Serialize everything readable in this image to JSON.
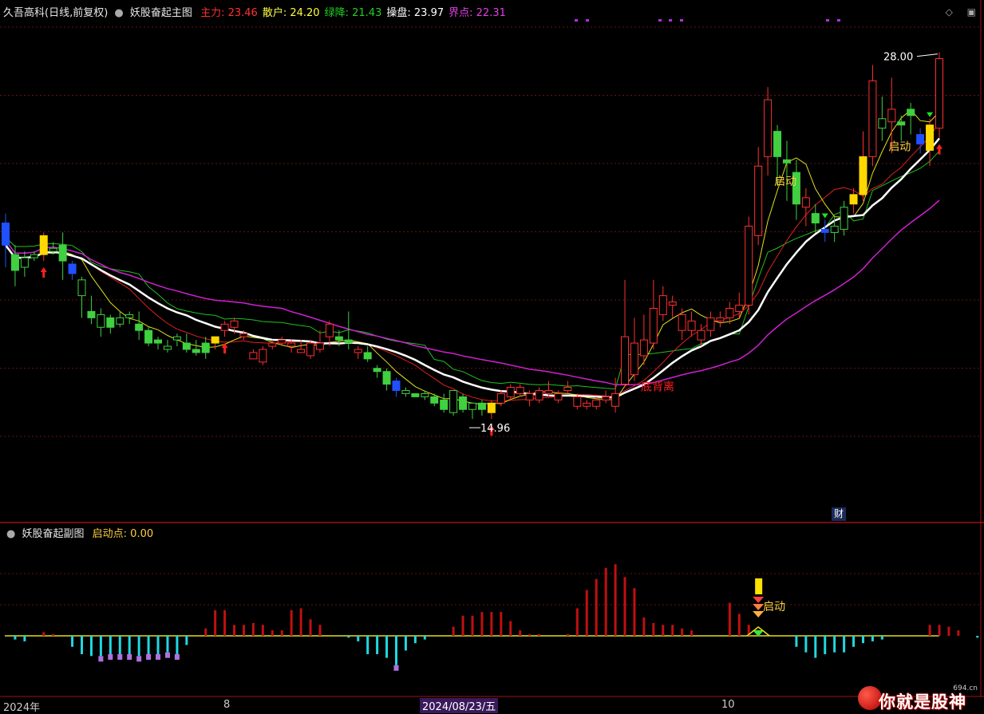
{
  "header": {
    "stock": "久吾高科(日线,前复权)",
    "main_indicator": "妖股奋起主图",
    "items": [
      {
        "label": "主力",
        "value": "23.46",
        "color": "#ff3030"
      },
      {
        "label": "散户",
        "value": "24.20",
        "color": "#ffff40"
      },
      {
        "label": "绿降",
        "value": "21.43",
        "color": "#20d020"
      },
      {
        "label": "操盘",
        "value": "23.97",
        "color": "#ffffff"
      },
      {
        "label": "界点",
        "value": "22.31",
        "color": "#e040e0"
      }
    ],
    "sep": ":"
  },
  "sub_header": {
    "indicator": "妖股奋起副图",
    "label": "启动点",
    "value": "0.00"
  },
  "window_buttons": [
    "◇",
    "▣"
  ],
  "date_axis": {
    "labels": [
      "2024年",
      "8",
      "10"
    ],
    "selected": "2024/08/23/五"
  },
  "logo": {
    "text": "你就是股神",
    "small": "694.cn"
  },
  "badge": "财",
  "chart_data": [
    {
      "type": "candlestick",
      "title": "妖股奋起主图",
      "ylim": [
        13.5,
        29
      ],
      "candles": [
        [
          22.6,
          21.9,
          22.9,
          21.2,
          "b"
        ],
        [
          21.6,
          21.1,
          21.9,
          20.6,
          "g"
        ],
        [
          21.2,
          21.5,
          21.7,
          20.9,
          "g"
        ],
        [
          21.5,
          21.6,
          21.7,
          21.4,
          "g"
        ],
        [
          21.6,
          22.2,
          22.3,
          21.4,
          "y"
        ],
        [
          21.7,
          21.8,
          22.0,
          21.6,
          "g"
        ],
        [
          21.9,
          21.4,
          22.3,
          20.8,
          "g"
        ],
        [
          21.3,
          21.0,
          21.4,
          20.8,
          "b"
        ],
        [
          20.3,
          20.8,
          20.9,
          19.6,
          "g"
        ],
        [
          19.8,
          19.6,
          20.3,
          19.4,
          "g"
        ],
        [
          19.3,
          19.7,
          19.9,
          19.0,
          "g"
        ],
        [
          19.6,
          19.3,
          19.7,
          19.1,
          "g"
        ],
        [
          19.4,
          19.6,
          19.8,
          19.3,
          "g"
        ],
        [
          19.6,
          19.7,
          19.8,
          19.4,
          "g"
        ],
        [
          19.4,
          19.2,
          19.8,
          18.9,
          "g"
        ],
        [
          19.2,
          18.8,
          19.3,
          18.7,
          "g"
        ],
        [
          18.9,
          18.8,
          19.0,
          18.6,
          "g"
        ],
        [
          18.6,
          18.7,
          18.9,
          18.5,
          "g"
        ],
        [
          18.9,
          19.0,
          19.1,
          18.7,
          "g"
        ],
        [
          18.8,
          18.6,
          19.1,
          18.5,
          "g"
        ],
        [
          18.6,
          18.5,
          18.9,
          18.4,
          "g"
        ],
        [
          18.8,
          18.5,
          19.0,
          18.3,
          "g"
        ],
        [
          19.0,
          18.8,
          19.0,
          18.6,
          "y"
        ],
        [
          19.2,
          19.4,
          19.5,
          19.0,
          "r"
        ],
        [
          19.5,
          19.3,
          19.6,
          19.1,
          "r"
        ],
        [
          19.0,
          19.1,
          19.2,
          18.9,
          "r"
        ],
        [
          18.5,
          18.3,
          18.6,
          18.3,
          "r"
        ],
        [
          18.2,
          18.6,
          18.7,
          18.1,
          "r"
        ],
        [
          18.7,
          18.8,
          18.9,
          18.6,
          "r"
        ],
        [
          18.8,
          18.9,
          19.0,
          18.7,
          "r"
        ],
        [
          18.8,
          18.7,
          18.9,
          18.5,
          "r"
        ],
        [
          18.5,
          18.6,
          18.9,
          18.5,
          "r"
        ],
        [
          18.4,
          18.8,
          18.9,
          18.3,
          "r"
        ],
        [
          18.8,
          18.6,
          19.2,
          18.5,
          "r"
        ],
        [
          19.0,
          19.4,
          19.5,
          18.7,
          "r"
        ],
        [
          19.0,
          18.9,
          19.2,
          18.7,
          "g"
        ],
        [
          18.9,
          18.8,
          19.8,
          18.6,
          "g"
        ],
        [
          18.6,
          18.5,
          18.7,
          18.3,
          "r"
        ],
        [
          18.5,
          18.3,
          18.7,
          18.2,
          "g"
        ],
        [
          18.0,
          17.9,
          18.1,
          17.7,
          "g"
        ],
        [
          17.9,
          17.5,
          18.0,
          17.3,
          "g"
        ],
        [
          17.6,
          17.3,
          17.7,
          17.1,
          "b"
        ],
        [
          17.2,
          17.3,
          17.4,
          17.1,
          "g"
        ],
        [
          17.2,
          17.1,
          17.2,
          17.1,
          "g"
        ],
        [
          17.1,
          17.2,
          17.3,
          17.0,
          "g"
        ],
        [
          17.1,
          16.9,
          17.2,
          16.8,
          "g"
        ],
        [
          17.0,
          16.7,
          17.2,
          16.6,
          "g"
        ],
        [
          16.6,
          17.3,
          17.3,
          16.5,
          "g"
        ],
        [
          17.1,
          16.7,
          17.2,
          16.6,
          "g"
        ],
        [
          16.7,
          16.9,
          16.9,
          16.4,
          "g"
        ],
        [
          16.9,
          16.7,
          17.0,
          16.5,
          "g"
        ],
        [
          16.6,
          16.9,
          17.0,
          16.4,
          "y"
        ],
        [
          16.9,
          17.2,
          17.3,
          16.8,
          "r"
        ],
        [
          17.1,
          17.4,
          17.5,
          17.0,
          "r"
        ],
        [
          17.2,
          17.4,
          17.5,
          17.1,
          "r"
        ],
        [
          17.2,
          17.0,
          17.3,
          16.8,
          "r"
        ],
        [
          17.0,
          17.3,
          17.4,
          16.9,
          "r"
        ],
        [
          17.3,
          17.2,
          17.6,
          17.1,
          "r"
        ],
        [
          17.0,
          17.2,
          17.3,
          16.9,
          "r"
        ],
        [
          17.4,
          17.3,
          17.6,
          17.2,
          "r"
        ],
        [
          17.1,
          16.8,
          17.2,
          16.7,
          "r"
        ],
        [
          16.8,
          16.9,
          17.0,
          16.7,
          "r"
        ],
        [
          16.8,
          17.0,
          17.1,
          16.7,
          "r"
        ],
        [
          17.0,
          17.1,
          17.3,
          16.9,
          "r"
        ],
        [
          16.8,
          17.2,
          17.7,
          16.6,
          "r"
        ],
        [
          17.5,
          19.0,
          20.8,
          17.4,
          "r"
        ],
        [
          17.8,
          18.8,
          19.6,
          17.6,
          "r"
        ],
        [
          18.4,
          18.9,
          19.7,
          18.1,
          "r"
        ],
        [
          18.8,
          19.9,
          20.8,
          18.6,
          "r"
        ],
        [
          19.7,
          20.3,
          20.6,
          19.5,
          "r"
        ],
        [
          20.1,
          20.0,
          20.3,
          19.6,
          "r"
        ],
        [
          19.2,
          19.7,
          19.9,
          18.9,
          "r"
        ],
        [
          19.2,
          19.5,
          19.8,
          19.0,
          "r"
        ],
        [
          19.2,
          18.9,
          19.4,
          18.7,
          "r"
        ],
        [
          19.2,
          19.6,
          19.8,
          19.0,
          "r"
        ],
        [
          19.6,
          19.5,
          19.8,
          19.3,
          "r"
        ],
        [
          19.6,
          19.9,
          20.1,
          19.4,
          "r"
        ],
        [
          19.8,
          20.0,
          20.4,
          19.6,
          "r"
        ],
        [
          20.0,
          22.5,
          22.8,
          19.7,
          "r"
        ],
        [
          22.2,
          24.4,
          25.0,
          21.9,
          "r"
        ],
        [
          24.7,
          26.5,
          26.9,
          24.1,
          "r"
        ],
        [
          25.5,
          24.7,
          25.7,
          23.8,
          "g"
        ],
        [
          24.6,
          24.5,
          25.2,
          23.3,
          "g"
        ],
        [
          24.2,
          23.2,
          24.6,
          22.7,
          "g"
        ],
        [
          23.1,
          23.4,
          23.7,
          22.5,
          "r"
        ],
        [
          22.9,
          22.6,
          23.2,
          22.3,
          "g"
        ],
        [
          22.4,
          22.3,
          22.7,
          22.0,
          "b"
        ],
        [
          22.3,
          22.5,
          22.8,
          22.0,
          "g"
        ],
        [
          22.4,
          23.1,
          23.3,
          22.2,
          "g"
        ],
        [
          23.2,
          23.5,
          23.7,
          22.9,
          "y"
        ],
        [
          23.5,
          24.7,
          25.5,
          23.3,
          "y"
        ],
        [
          24.7,
          27.1,
          27.6,
          24.4,
          "r"
        ],
        [
          25.6,
          25.9,
          26.6,
          25.2,
          "g"
        ],
        [
          25.8,
          26.2,
          27.2,
          24.8,
          "r"
        ],
        [
          25.8,
          25.7,
          26.0,
          25.2,
          "g"
        ],
        [
          26.2,
          26.0,
          26.4,
          25.4,
          "g"
        ],
        [
          25.1,
          25.4,
          25.6,
          24.8,
          "b"
        ],
        [
          24.9,
          25.7,
          25.9,
          24.4,
          "y"
        ],
        [
          25.6,
          27.8,
          28.0,
          25.3,
          "r"
        ]
      ],
      "markers": {
        "up_arrows": [
          4,
          23,
          51,
          98
        ],
        "green_arrows": [
          86,
          97
        ],
        "labels": [
          {
            "text": "底背离",
            "idx": 66,
            "color": "#ff2020"
          },
          {
            "text": "启动",
            "idx": 80,
            "color": "#ffd040"
          },
          {
            "text": "启动",
            "idx": 92,
            "color": "#ffd040"
          }
        ],
        "high_label": "28.00",
        "low_label": "14.96"
      }
    },
    {
      "type": "bar",
      "title": "妖股奋起副图",
      "series": [
        {
          "values": [
            0,
            -0.2,
            -0.3,
            0,
            0.2,
            0.1,
            0,
            -0.6,
            -1.0,
            -1.1,
            -1.1,
            -1.0,
            -1.0,
            -1.0,
            -1.1,
            -1.0,
            -1.0,
            -0.9,
            -1.0,
            -0.5,
            0,
            0.4,
            1.4,
            1.4,
            0.6,
            0.6,
            0.7,
            0.6,
            0.3,
            0.3,
            1.4,
            1.5,
            0.9,
            0.6,
            0,
            0,
            -0.1,
            -0.3,
            -1.0,
            -1.0,
            -1.2,
            -1.6,
            -0.8,
            -0.4,
            -0.2,
            0,
            0,
            0.5,
            1.1,
            1.1,
            1.3,
            1.3,
            1.3,
            0.8,
            0.3,
            0.1,
            0.1,
            0,
            0,
            0.1,
            1.5,
            2.5,
            3.1,
            3.7,
            3.9,
            3.2,
            2.6,
            1.0,
            0.7,
            0.6,
            0.6,
            0.4,
            0.3,
            0,
            0,
            0,
            1.8,
            1.2,
            0.6,
            0.1,
            0,
            0,
            0,
            -0.6,
            -0.9,
            -1.2,
            -1.0,
            -0.9,
            -0.9,
            -0.6,
            -0.4,
            -0.3,
            -0.2,
            0,
            0,
            0,
            0,
            0.6,
            0.6,
            0.5,
            0.3,
            0,
            -0.1,
            -0.3
          ]
        }
      ],
      "markers": {
        "label": "启动",
        "tips_idx": [
          10,
          11,
          12,
          13,
          14,
          15,
          16,
          17,
          18,
          41
        ]
      }
    }
  ]
}
